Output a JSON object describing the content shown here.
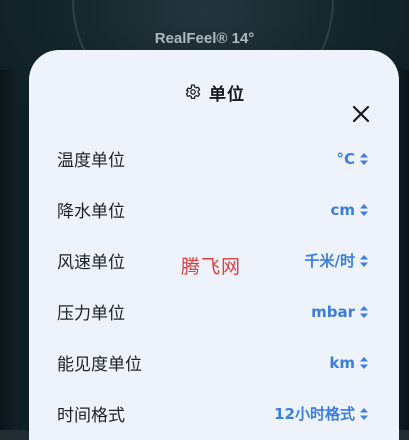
{
  "background": {
    "realfeel_text": "RealFeel® 14°"
  },
  "sheet": {
    "title": "单位",
    "title_icon": "gear-icon",
    "close_icon": "close-icon"
  },
  "rows": [
    {
      "label": "温度单位",
      "value": "°C"
    },
    {
      "label": "降水单位",
      "value": "cm"
    },
    {
      "label": "风速单位",
      "value": "千米/时"
    },
    {
      "label": "压力单位",
      "value": "mbar"
    },
    {
      "label": "能见度单位",
      "value": "km"
    },
    {
      "label": "时间格式",
      "value": "12小时格式"
    }
  ],
  "watermark": "腾飞网",
  "colors": {
    "accent": "#3b7de0",
    "sheet_bg": "#eef3fb",
    "app_bg": "#0f1e24",
    "watermark": "#e23b3b"
  }
}
